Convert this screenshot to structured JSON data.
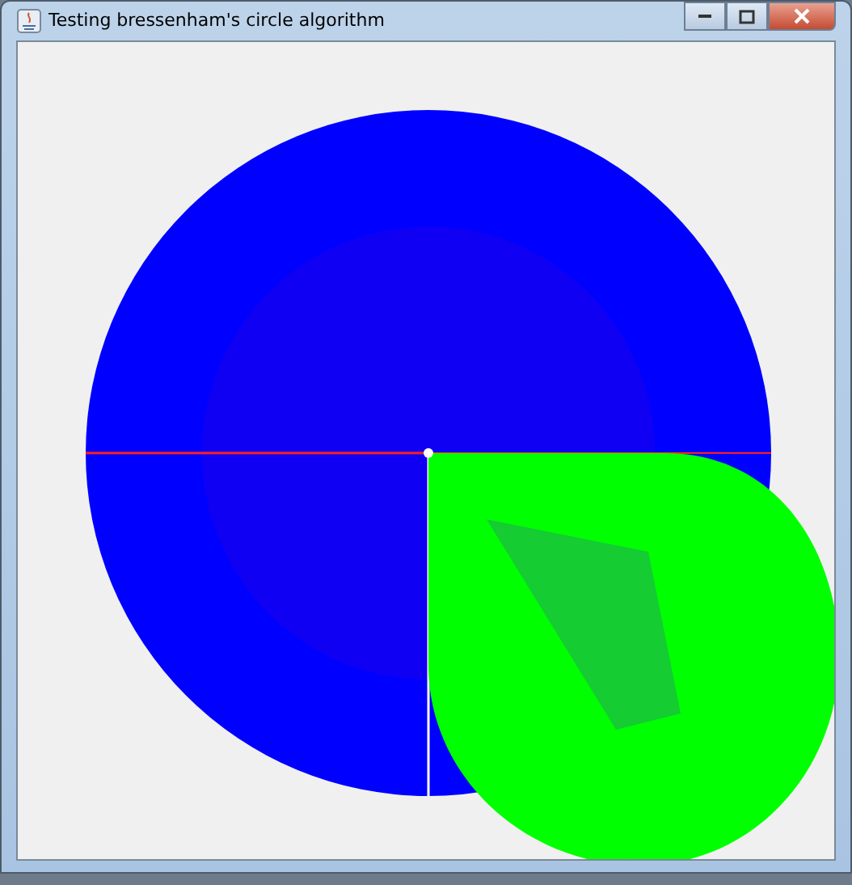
{
  "window": {
    "title": "Testing bressenham's circle algorithm"
  }
}
